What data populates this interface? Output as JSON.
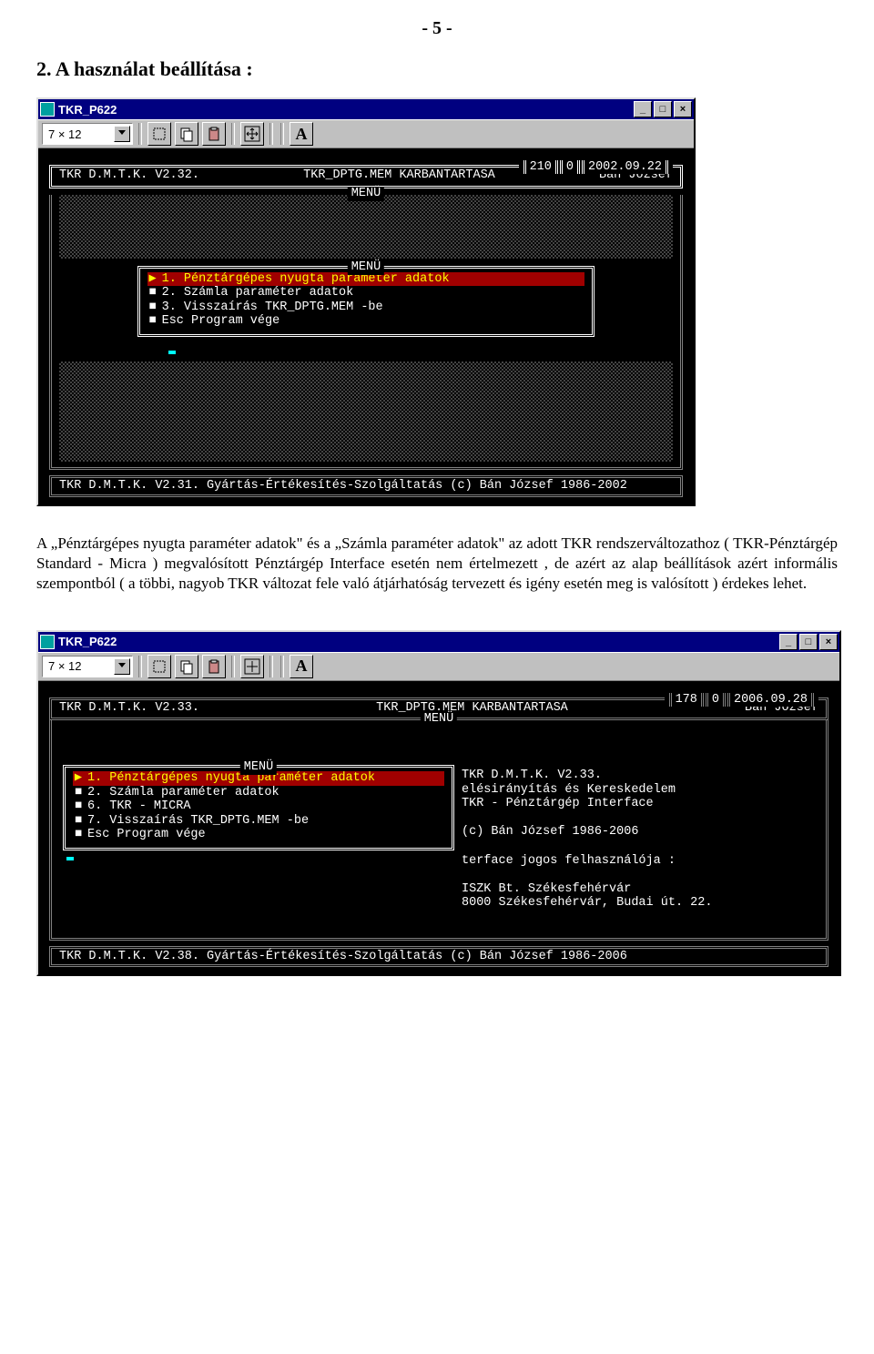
{
  "page_number": "-  5  -",
  "section_title": "2. A használat beállítása :",
  "body_text": "A „Pénztárgépes nyugta paraméter adatok\" és a „Számla paraméter adatok\" az adott TKR rendszerváltozathoz ( TKR-Pénztárgép Standard - Micra ) megvalósított Pénztárgép Interface esetén nem értelmezett , de azért az alap beállítások azért informális szempontból ( a többi, nagyob  TKR változat fele való átjárhatóság tervezett és igény esetén meg is valósított ) érdekes lehet.",
  "win1": {
    "title": "TKR_P622",
    "toolbar_select": "7 × 12",
    "toolbar_font": "A",
    "header_left": "TKR D.M.T.K. V2.32.",
    "header_center": "TKR_DPTG.MEM KARBANTARTASA",
    "header_sub": "MENÜ",
    "header_right_name": "Bán József",
    "status_left": "210",
    "status_mid": "0",
    "status_right": "2002.09.22",
    "menu_title": "MENÜ",
    "menu_items": [
      {
        "bullet": "▶",
        "label": "1. Pénztárgépes nyugta paraméter adatok",
        "selected": true
      },
      {
        "bullet": "■",
        "label": "2. Számla paraméter adatok",
        "selected": false
      },
      {
        "bullet": "■",
        "label": "3. Visszaírás TKR_DPTG.MEM -be",
        "selected": false
      },
      {
        "bullet": "■",
        "label": "Esc Program vége",
        "selected": false
      }
    ],
    "footer": "TKR D.M.T.K. V2.31. Gyártás-Értékesítés-Szolgáltatás (c) Bán József 1986-2002"
  },
  "win2": {
    "title": "TKR_P622",
    "toolbar_select": "7 × 12",
    "toolbar_font": "A",
    "header_left": "TKR D.M.T.K. V2.33.",
    "header_center": "TKR_DPTG.MEM KARBANTARTASA",
    "header_sub": "MENÜ",
    "header_right_name": "Bán József",
    "status_left": "178",
    "status_mid": "0",
    "status_right": "2006.09.28",
    "menu_title": "MENÜ",
    "menu_items": [
      {
        "bullet": "▶",
        "label": "1. Pénztárgépes nyugta paraméter adatok",
        "selected": true
      },
      {
        "bullet": "■",
        "label": "2. Számla paraméter adatok",
        "selected": false
      },
      {
        "bullet": "■",
        "label": "6. TKR - MICRA",
        "selected": false
      },
      {
        "bullet": "■",
        "label": "7. Visszaírás TKR_DPTG.MEM -be",
        "selected": false
      },
      {
        "bullet": "■",
        "label": "Esc Program vége",
        "selected": false
      }
    ],
    "right_panel": [
      "TKR D.M.T.K. V2.33.",
      "elésirányítás és Kereskedelem",
      "TKR - Pénztárgép Interface",
      "",
      "(c) Bán József 1986-2006",
      "",
      "terface jogos felhasználója :",
      "",
      "ISZK Bt. Székesfehérvár",
      "8000 Székesfehérvár, Budai út. 22."
    ],
    "footer": "TKR D.M.T.K. V2.38. Gyártás-Értékesítés-Szolgáltatás (c) Bán József 1986-2006"
  }
}
